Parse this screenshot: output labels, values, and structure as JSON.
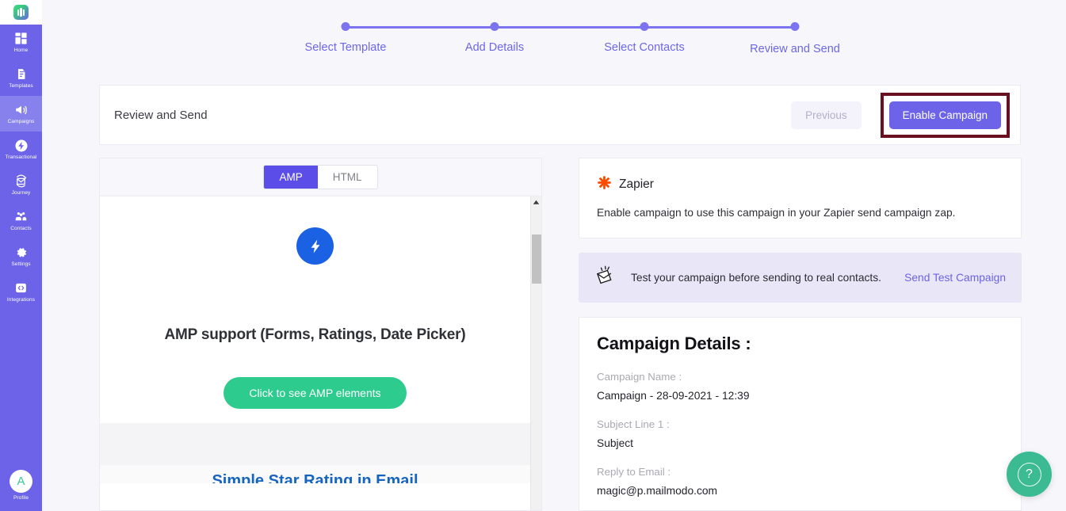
{
  "sidebar": {
    "logo_name": "mailmodo-logo",
    "items": [
      {
        "label": "Home",
        "icon": "grid-icon",
        "active": false
      },
      {
        "label": "Templates",
        "icon": "document-icon",
        "active": false
      },
      {
        "label": "Campaigns",
        "icon": "megaphone-icon",
        "active": true
      },
      {
        "label": "Transactional",
        "icon": "bolt-circle-icon",
        "active": false
      },
      {
        "label": "Journey",
        "icon": "envelope-arrows-icon",
        "active": false
      },
      {
        "label": "Contacts",
        "icon": "people-icon",
        "active": false
      },
      {
        "label": "Settings",
        "icon": "gear-icon",
        "active": false
      },
      {
        "label": "Integrations",
        "icon": "code-box-icon",
        "active": false
      }
    ],
    "profile": {
      "label": "Profile",
      "initial": "A"
    }
  },
  "stepper": {
    "steps": [
      {
        "label": "Select Template"
      },
      {
        "label": "Add Details"
      },
      {
        "label": "Select Contacts"
      },
      {
        "label": "Review and Send"
      }
    ],
    "accent_color": "#7b73ef"
  },
  "header": {
    "title": "Review and Send",
    "previous_label": "Previous",
    "enable_label": "Enable Campaign",
    "highlight_color": "#6b1020"
  },
  "preview": {
    "tabs": [
      {
        "label": "AMP",
        "active": true
      },
      {
        "label": "HTML",
        "active": false
      }
    ],
    "email": {
      "badge_icon": "amp-bolt-icon",
      "headline": "AMP support (Forms, Ratings, Date Picker)",
      "cta_label": "Click to see AMP elements",
      "next_section_heading": "Simple Star Rating in Email"
    },
    "scrollbar": {
      "up_arrow_icon": "caret-up-icon"
    }
  },
  "zapier": {
    "icon": "zapier-asterisk-icon",
    "name": "Zapier",
    "description": "Enable campaign to use this campaign in your Zapier send campaign zap.",
    "brand_color": "#ff4a00"
  },
  "test_banner": {
    "icon": "flying-envelope-icon",
    "text": "Test your campaign before sending to real contacts.",
    "link_label": "Send Test Campaign"
  },
  "campaign_details": {
    "title": "Campaign Details :",
    "fields": [
      {
        "label": "Campaign Name :",
        "value": "Campaign - 28-09-2021 - 12:39"
      },
      {
        "label": "Subject Line 1 :",
        "value": "Subject"
      },
      {
        "label": "Reply to Email :",
        "value": "magic@p.mailmodo.com"
      }
    ]
  },
  "help": {
    "icon": "question-mark-icon",
    "glyph": "?"
  }
}
